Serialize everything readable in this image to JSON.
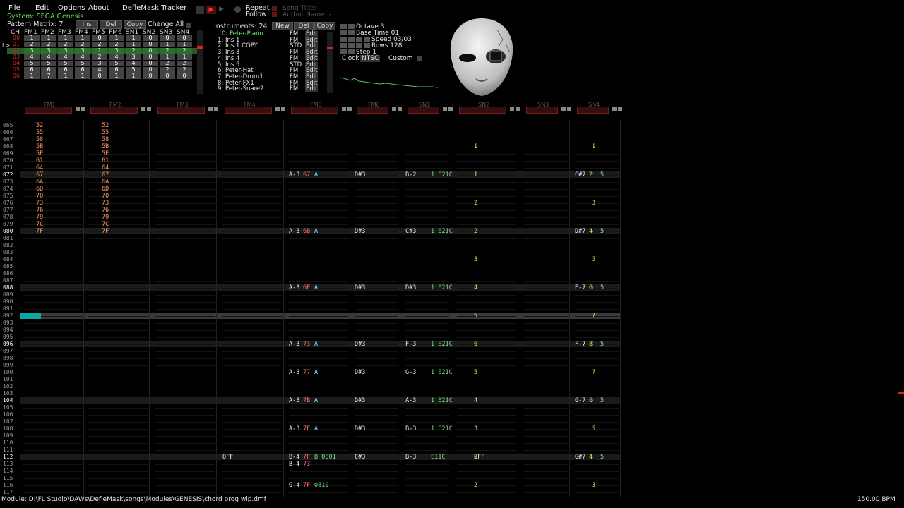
{
  "menu": {
    "file": "File",
    "edit": "Edit",
    "options": "Options",
    "about": "About",
    "app": "DefleMask Tracker"
  },
  "system": "System: SEGA Genesis",
  "transport": {
    "repeat": "Repeat",
    "follow": "Follow",
    "song_title": "Song Title: -",
    "author": "Author Name: -"
  },
  "pattern_matrix": {
    "label": "Pattern Matrix: 7",
    "ins": "Ins",
    "del": "Del",
    "copy": "Copy",
    "change_all": "Change All",
    "headers": [
      "CH",
      "FM1",
      "FM2",
      "FM3",
      "FM4",
      "FM5",
      "FM6",
      "SN1",
      "SN2",
      "SN3",
      "SN4"
    ],
    "rows": [
      {
        "id": "00",
        "cells": [
          "1",
          "1",
          "1",
          "1",
          "0",
          "1",
          "1",
          "0",
          "0",
          "0"
        ]
      },
      {
        "id": "01",
        "cells": [
          "2",
          "2",
          "2",
          "2",
          "2",
          "2",
          "1",
          "0",
          "1",
          "1"
        ]
      },
      {
        "id": "02",
        "cells": [
          "3",
          "3",
          "3",
          "3",
          "1",
          "3",
          "2",
          "0",
          "2",
          "2"
        ],
        "selected": true
      },
      {
        "id": "03",
        "cells": [
          "4",
          "4",
          "4",
          "4",
          "2",
          "4",
          "3",
          "0",
          "1",
          "1"
        ]
      },
      {
        "id": "04",
        "cells": [
          "5",
          "5",
          "5",
          "5",
          "3",
          "5",
          "4",
          "0",
          "2",
          "2"
        ]
      },
      {
        "id": "05",
        "cells": [
          "6",
          "6",
          "6",
          "6",
          "4",
          "6",
          "5",
          "0",
          "2",
          "2"
        ]
      },
      {
        "id": "06",
        "cells": [
          "1",
          "7",
          "1",
          "1",
          "0",
          "1",
          "1",
          "0",
          "0",
          "0"
        ]
      }
    ]
  },
  "instruments": {
    "label": "Instruments: 24",
    "new": "New",
    "del": "Del",
    "copy": "Copy",
    "items": [
      {
        "name": "0: Peter-Piano",
        "type": "FM",
        "edit": "Edit",
        "selected": true
      },
      {
        "name": "1: Ins 1",
        "type": "FM",
        "edit": "Edit"
      },
      {
        "name": "2: Ins 1 COPY",
        "type": "STD",
        "edit": "Edit"
      },
      {
        "name": "3: Ins 3",
        "type": "FM",
        "edit": "Edit"
      },
      {
        "name": "4: Ins 4",
        "type": "FM",
        "edit": "Edit"
      },
      {
        "name": "5: Ins 5",
        "type": "STD",
        "edit": "Edit"
      },
      {
        "name": "6: Peter-Hat",
        "type": "FM",
        "edit": "Edit"
      },
      {
        "name": "7: Peter-Drum1",
        "type": "FM",
        "edit": "Edit"
      },
      {
        "name": "8: Peter-FX1",
        "type": "FM",
        "edit": "Edit"
      },
      {
        "name": "9: Peter-Snare2",
        "type": "FM",
        "edit": "Edit"
      }
    ]
  },
  "settings": {
    "octave": "Octave 3",
    "base_time": "Base Time 01",
    "speed": "Speed 03/03",
    "rows": "Rows 128",
    "step": "Step 1",
    "clock": "Clock",
    "clock_val": "NTSC",
    "custom": "Custom"
  },
  "channels": [
    "FM1",
    "FM2",
    "FM3",
    "FM4",
    "FM5",
    "FM6",
    "SN1",
    "SN2",
    "SN3",
    "SN4"
  ],
  "rows": [
    "065",
    "066",
    "067",
    "068",
    "069",
    "070",
    "071",
    "072",
    "073",
    "074",
    "075",
    "076",
    "077",
    "078",
    "079",
    "080",
    "081",
    "082",
    "083",
    "084",
    "085",
    "086",
    "087",
    "088",
    "089",
    "090",
    "091",
    "092",
    "093",
    "094",
    "095",
    "096",
    "097",
    "098",
    "099",
    "100",
    "101",
    "102",
    "103",
    "104",
    "105",
    "106",
    "107",
    "108",
    "109",
    "110",
    "111",
    "112",
    "113",
    "114",
    "115",
    "116",
    "117"
  ],
  "cells": [
    {
      "r": 0,
      "c": 0,
      "k": "n-hex",
      "t": "52"
    },
    {
      "r": 0,
      "c": 1,
      "k": "n-hex",
      "t": "52"
    },
    {
      "r": 1,
      "c": 0,
      "k": "n-hex",
      "t": "55"
    },
    {
      "r": 1,
      "c": 1,
      "k": "n-hex",
      "t": "55"
    },
    {
      "r": 2,
      "c": 0,
      "k": "n-hex",
      "t": "58"
    },
    {
      "r": 2,
      "c": 1,
      "k": "n-hex",
      "t": "58"
    },
    {
      "r": 3,
      "c": 0,
      "k": "n-hex",
      "t": "5B"
    },
    {
      "r": 3,
      "c": 1,
      "k": "n-hex",
      "t": "5B"
    },
    {
      "r": 4,
      "c": 0,
      "k": "n-hex",
      "t": "5E"
    },
    {
      "r": 4,
      "c": 1,
      "k": "n-hex",
      "t": "5E"
    },
    {
      "r": 5,
      "c": 0,
      "k": "n-hex",
      "t": "61"
    },
    {
      "r": 5,
      "c": 1,
      "k": "n-hex",
      "t": "61"
    },
    {
      "r": 6,
      "c": 0,
      "k": "n-hex",
      "t": "64"
    },
    {
      "r": 6,
      "c": 1,
      "k": "n-hex",
      "t": "64"
    },
    {
      "r": 7,
      "c": 0,
      "k": "n-hex",
      "t": "67"
    },
    {
      "r": 7,
      "c": 1,
      "k": "n-hex",
      "t": "67"
    },
    {
      "r": 8,
      "c": 0,
      "k": "n-hex",
      "t": "6A"
    },
    {
      "r": 8,
      "c": 1,
      "k": "n-hex",
      "t": "6A"
    },
    {
      "r": 9,
      "c": 0,
      "k": "n-hex",
      "t": "6D"
    },
    {
      "r": 9,
      "c": 1,
      "k": "n-hex",
      "t": "6D"
    },
    {
      "r": 10,
      "c": 0,
      "k": "n-hex",
      "t": "70"
    },
    {
      "r": 10,
      "c": 1,
      "k": "n-hex",
      "t": "70"
    },
    {
      "r": 11,
      "c": 0,
      "k": "n-hex",
      "t": "73"
    },
    {
      "r": 11,
      "c": 1,
      "k": "n-hex",
      "t": "73"
    },
    {
      "r": 12,
      "c": 0,
      "k": "n-hex",
      "t": "76"
    },
    {
      "r": 12,
      "c": 1,
      "k": "n-hex",
      "t": "76"
    },
    {
      "r": 13,
      "c": 0,
      "k": "n-hex",
      "t": "79"
    },
    {
      "r": 13,
      "c": 1,
      "k": "n-hex",
      "t": "79"
    },
    {
      "r": 14,
      "c": 0,
      "k": "n-hex",
      "t": "7C"
    },
    {
      "r": 14,
      "c": 1,
      "k": "n-hex",
      "t": "7C"
    },
    {
      "r": 15,
      "c": 0,
      "k": "n-hex",
      "t": "7F"
    },
    {
      "r": 15,
      "c": 1,
      "k": "n-hex",
      "t": "7F"
    },
    {
      "r": 3,
      "c": 7,
      "k": "n-num",
      "t": "1"
    },
    {
      "r": 3,
      "c": 9,
      "k": "n-num",
      "t": "1"
    },
    {
      "r": 7,
      "c": 4,
      "k": "n-note",
      "t": "A-3"
    },
    {
      "r": 7,
      "c": 4,
      "o": 1,
      "k": "n-vol",
      "t": "67"
    },
    {
      "r": 7,
      "c": 4,
      "o": 2,
      "k": "n-ins",
      "t": "A"
    },
    {
      "r": 7,
      "c": 5,
      "k": "n-note",
      "t": "D#3"
    },
    {
      "r": 7,
      "c": 6,
      "k": "n-note",
      "t": "B-2"
    },
    {
      "r": 7,
      "c": 6,
      "o": 2,
      "k": "n-fx",
      "t": "1 E21C"
    },
    {
      "r": 7,
      "c": 7,
      "k": "n-num",
      "t": "1"
    },
    {
      "r": 7,
      "c": 9,
      "k": "n-note",
      "t": "C#7"
    },
    {
      "r": 7,
      "c": 9,
      "o": 1,
      "k": "n-num",
      "t": "2"
    },
    {
      "r": 7,
      "c": 9,
      "o": 2,
      "k": "n-ins",
      "t": "5"
    },
    {
      "r": 11,
      "c": 7,
      "k": "n-num",
      "t": "2"
    },
    {
      "r": 11,
      "c": 9,
      "k": "n-num",
      "t": "3"
    },
    {
      "r": 15,
      "c": 4,
      "k": "n-note",
      "t": "A-3"
    },
    {
      "r": 15,
      "c": 4,
      "o": 1,
      "k": "n-vol",
      "t": "6B"
    },
    {
      "r": 15,
      "c": 4,
      "o": 2,
      "k": "n-ins",
      "t": "A"
    },
    {
      "r": 15,
      "c": 5,
      "k": "n-note",
      "t": "D#3"
    },
    {
      "r": 15,
      "c": 6,
      "k": "n-note",
      "t": "C#3"
    },
    {
      "r": 15,
      "c": 6,
      "o": 2,
      "k": "n-fx",
      "t": "1 E21C"
    },
    {
      "r": 15,
      "c": 7,
      "k": "n-num",
      "t": "2"
    },
    {
      "r": 15,
      "c": 9,
      "k": "n-note",
      "t": "D#7"
    },
    {
      "r": 15,
      "c": 9,
      "o": 1,
      "k": "n-num",
      "t": "4"
    },
    {
      "r": 15,
      "c": 9,
      "o": 2,
      "k": "n-ins",
      "t": "5"
    },
    {
      "r": 19,
      "c": 7,
      "k": "n-num",
      "t": "3"
    },
    {
      "r": 19,
      "c": 9,
      "k": "n-num",
      "t": "5"
    },
    {
      "r": 23,
      "c": 4,
      "k": "n-note",
      "t": "A-3"
    },
    {
      "r": 23,
      "c": 4,
      "o": 1,
      "k": "n-vol",
      "t": "6F"
    },
    {
      "r": 23,
      "c": 4,
      "o": 2,
      "k": "n-ins",
      "t": "A"
    },
    {
      "r": 23,
      "c": 5,
      "k": "n-note",
      "t": "D#3"
    },
    {
      "r": 23,
      "c": 6,
      "k": "n-note",
      "t": "D#3"
    },
    {
      "r": 23,
      "c": 6,
      "o": 2,
      "k": "n-fx",
      "t": "1 E21C"
    },
    {
      "r": 23,
      "c": 7,
      "k": "n-num",
      "t": "4"
    },
    {
      "r": 23,
      "c": 9,
      "k": "n-note",
      "t": "E-7"
    },
    {
      "r": 23,
      "c": 9,
      "o": 1,
      "k": "n-num",
      "t": "6"
    },
    {
      "r": 23,
      "c": 9,
      "o": 2,
      "k": "n-ins",
      "t": "5"
    },
    {
      "r": 27,
      "c": 7,
      "k": "n-num",
      "t": "5"
    },
    {
      "r": 27,
      "c": 9,
      "k": "n-num",
      "t": "7"
    },
    {
      "r": 31,
      "c": 4,
      "k": "n-note",
      "t": "A-3"
    },
    {
      "r": 31,
      "c": 4,
      "o": 1,
      "k": "n-vol",
      "t": "73"
    },
    {
      "r": 31,
      "c": 4,
      "o": 2,
      "k": "n-ins",
      "t": "A"
    },
    {
      "r": 31,
      "c": 5,
      "k": "n-note",
      "t": "D#3"
    },
    {
      "r": 31,
      "c": 6,
      "k": "n-note",
      "t": "F-3"
    },
    {
      "r": 31,
      "c": 6,
      "o": 2,
      "k": "n-fx",
      "t": "1 E21C"
    },
    {
      "r": 31,
      "c": 7,
      "k": "n-num",
      "t": "6"
    },
    {
      "r": 31,
      "c": 9,
      "k": "n-note",
      "t": "F-7"
    },
    {
      "r": 31,
      "c": 9,
      "o": 1,
      "k": "n-num",
      "t": "8"
    },
    {
      "r": 31,
      "c": 9,
      "o": 2,
      "k": "n-ins",
      "t": "5"
    },
    {
      "r": 35,
      "c": 4,
      "k": "n-note",
      "t": "A-3"
    },
    {
      "r": 35,
      "c": 4,
      "o": 1,
      "k": "n-vol",
      "t": "77"
    },
    {
      "r": 35,
      "c": 4,
      "o": 2,
      "k": "n-ins",
      "t": "A"
    },
    {
      "r": 35,
      "c": 5,
      "k": "n-note",
      "t": "D#3"
    },
    {
      "r": 35,
      "c": 6,
      "k": "n-note",
      "t": "G-3"
    },
    {
      "r": 35,
      "c": 6,
      "o": 2,
      "k": "n-fx",
      "t": "1 E21C"
    },
    {
      "r": 35,
      "c": 7,
      "k": "n-num",
      "t": "5"
    },
    {
      "r": 35,
      "c": 9,
      "k": "n-num",
      "t": "7"
    },
    {
      "r": 39,
      "c": 4,
      "k": "n-note",
      "t": "A-3"
    },
    {
      "r": 39,
      "c": 4,
      "o": 1,
      "k": "n-vol",
      "t": "7B"
    },
    {
      "r": 39,
      "c": 4,
      "o": 2,
      "k": "n-ins",
      "t": "A"
    },
    {
      "r": 39,
      "c": 5,
      "k": "n-note",
      "t": "D#3"
    },
    {
      "r": 39,
      "c": 6,
      "k": "n-note",
      "t": "A-3"
    },
    {
      "r": 39,
      "c": 6,
      "o": 2,
      "k": "n-fx",
      "t": "1 E21C"
    },
    {
      "r": 39,
      "c": 7,
      "k": "n-num",
      "t": "4"
    },
    {
      "r": 39,
      "c": 9,
      "k": "n-note",
      "t": "G-7"
    },
    {
      "r": 39,
      "c": 9,
      "o": 1,
      "k": "n-num",
      "t": "6"
    },
    {
      "r": 39,
      "c": 9,
      "o": 2,
      "k": "n-ins",
      "t": "5"
    },
    {
      "r": 43,
      "c": 4,
      "k": "n-note",
      "t": "A-3"
    },
    {
      "r": 43,
      "c": 4,
      "o": 1,
      "k": "n-vol",
      "t": "7F"
    },
    {
      "r": 43,
      "c": 4,
      "o": 2,
      "k": "n-ins",
      "t": "A"
    },
    {
      "r": 43,
      "c": 5,
      "k": "n-note",
      "t": "D#3"
    },
    {
      "r": 43,
      "c": 6,
      "k": "n-note",
      "t": "B-3"
    },
    {
      "r": 43,
      "c": 6,
      "o": 2,
      "k": "n-fx",
      "t": "1 E21C"
    },
    {
      "r": 43,
      "c": 7,
      "k": "n-num",
      "t": "3"
    },
    {
      "r": 43,
      "c": 9,
      "k": "n-num",
      "t": "5"
    },
    {
      "r": 47,
      "c": 3,
      "k": "n-note",
      "t": "OFF"
    },
    {
      "r": 47,
      "c": 4,
      "k": "n-note",
      "t": "B-4"
    },
    {
      "r": 47,
      "c": 4,
      "o": 1,
      "k": "n-vol",
      "t": "7F"
    },
    {
      "r": 47,
      "c": 4,
      "o": 2,
      "k": "n-fx",
      "t": "B 0801"
    },
    {
      "r": 47,
      "c": 5,
      "k": "n-note",
      "t": "C#3"
    },
    {
      "r": 47,
      "c": 6,
      "k": "n-note",
      "t": "B-3"
    },
    {
      "r": 47,
      "c": 6,
      "o": 2,
      "k": "n-fx",
      "t": "E11C"
    },
    {
      "r": 47,
      "c": 7,
      "k": "n-note",
      "t": "OFF"
    },
    {
      "r": 47,
      "c": 7,
      "o": 1,
      "k": "n-num",
      "t": "2"
    },
    {
      "r": 47,
      "c": 9,
      "k": "n-note",
      "t": "G#7"
    },
    {
      "r": 47,
      "c": 9,
      "o": 1,
      "k": "n-num",
      "t": "4"
    },
    {
      "r": 47,
      "c": 9,
      "o": 2,
      "k": "n-ins",
      "t": "5"
    },
    {
      "r": 48,
      "c": 4,
      "k": "n-note",
      "t": "B-4"
    },
    {
      "r": 48,
      "c": 4,
      "o": 1,
      "k": "n-vol",
      "t": "73"
    },
    {
      "r": 51,
      "c": 4,
      "k": "n-note",
      "t": "G-4"
    },
    {
      "r": 51,
      "c": 4,
      "o": 1,
      "k": "n-vol",
      "t": "7F"
    },
    {
      "r": 51,
      "c": 4,
      "o": 2,
      "k": "n-fx",
      "t": "0810"
    },
    {
      "r": 51,
      "c": 7,
      "k": "n-num",
      "t": "2"
    },
    {
      "r": 51,
      "c": 9,
      "k": "n-num",
      "t": "3"
    }
  ],
  "status": {
    "module": "Module: D:\\FL Studio\\DAWs\\DefleMask\\songs\\Modules\\GENESIS\\chord prog wip.dmf",
    "bpm": "150.00 BPM"
  }
}
